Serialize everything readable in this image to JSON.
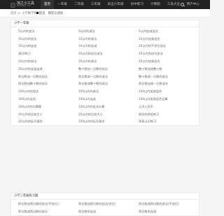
{
  "header": {
    "logo": {
      "name": "加之小工具",
      "sub": "www.jiazhi.com"
    },
    "nav": [
      {
        "label": "首页"
      },
      {
        "label": "一年级"
      },
      {
        "label": "二年级"
      },
      {
        "label": "三年级"
      },
      {
        "label": "四五六年级"
      },
      {
        "label": "初中练习"
      },
      {
        "label": "计算题"
      },
      {
        "label": "工具大全"
      }
    ],
    "user_label": "用户中心"
  },
  "breadcrumb": {
    "home": "首页",
    "sep": ">",
    "current": "小学数学练习"
  },
  "tabs": [
    {
      "label": "首页"
    },
    {
      "label": "随堂与测试"
    }
  ],
  "sections": [
    {
      "title": "小学一年级",
      "items": [
        "5以内的加法",
        "5以内的减法",
        "5以内加减混合",
        "10以内的加法",
        "10以内的减法",
        "10以内加减混合",
        "10以内的连加",
        "10以内的连减",
        "20以内的不进位加法",
        "凑10练习",
        "20以内的退位减法",
        "20以内的进位加法",
        "20以内的加法",
        "20以内的减法",
        "20以内加减混合",
        "20以内的连加连减",
        "整十数加一位数的加法",
        "整十数加减整十数",
        "两位数加一位数的加法",
        "两位数减一位数的减法",
        "整十数减一位数的减法",
        "两位数加整十数的加法",
        "两位数减整十数的减法",
        "两位数加减一位数混合",
        "100以内的加法",
        "100以内的减法",
        "100以内加减混合",
        "100以内连加",
        "100以内连减",
        "100以内加减混合运算",
        "100以内的口算题",
        "100以内的竖式计算",
        "认识人民币",
        "10以内的比较大小",
        "20以内的比较大小",
        "图形的拼组练习",
        "20以内的括号填空",
        "100以内的括号填空",
        "钟表认识练习"
      ]
    },
    {
      "title": "小学二年级练习题",
      "items": [
        "两位数加两位数的加法(不进位)",
        "两位数加两位数的加法(进位)",
        "两位数减两位数的减法(不退位)",
        "两位数减两位数的减法",
        "两位数的连加",
        "两位数的连减"
      ]
    }
  ]
}
